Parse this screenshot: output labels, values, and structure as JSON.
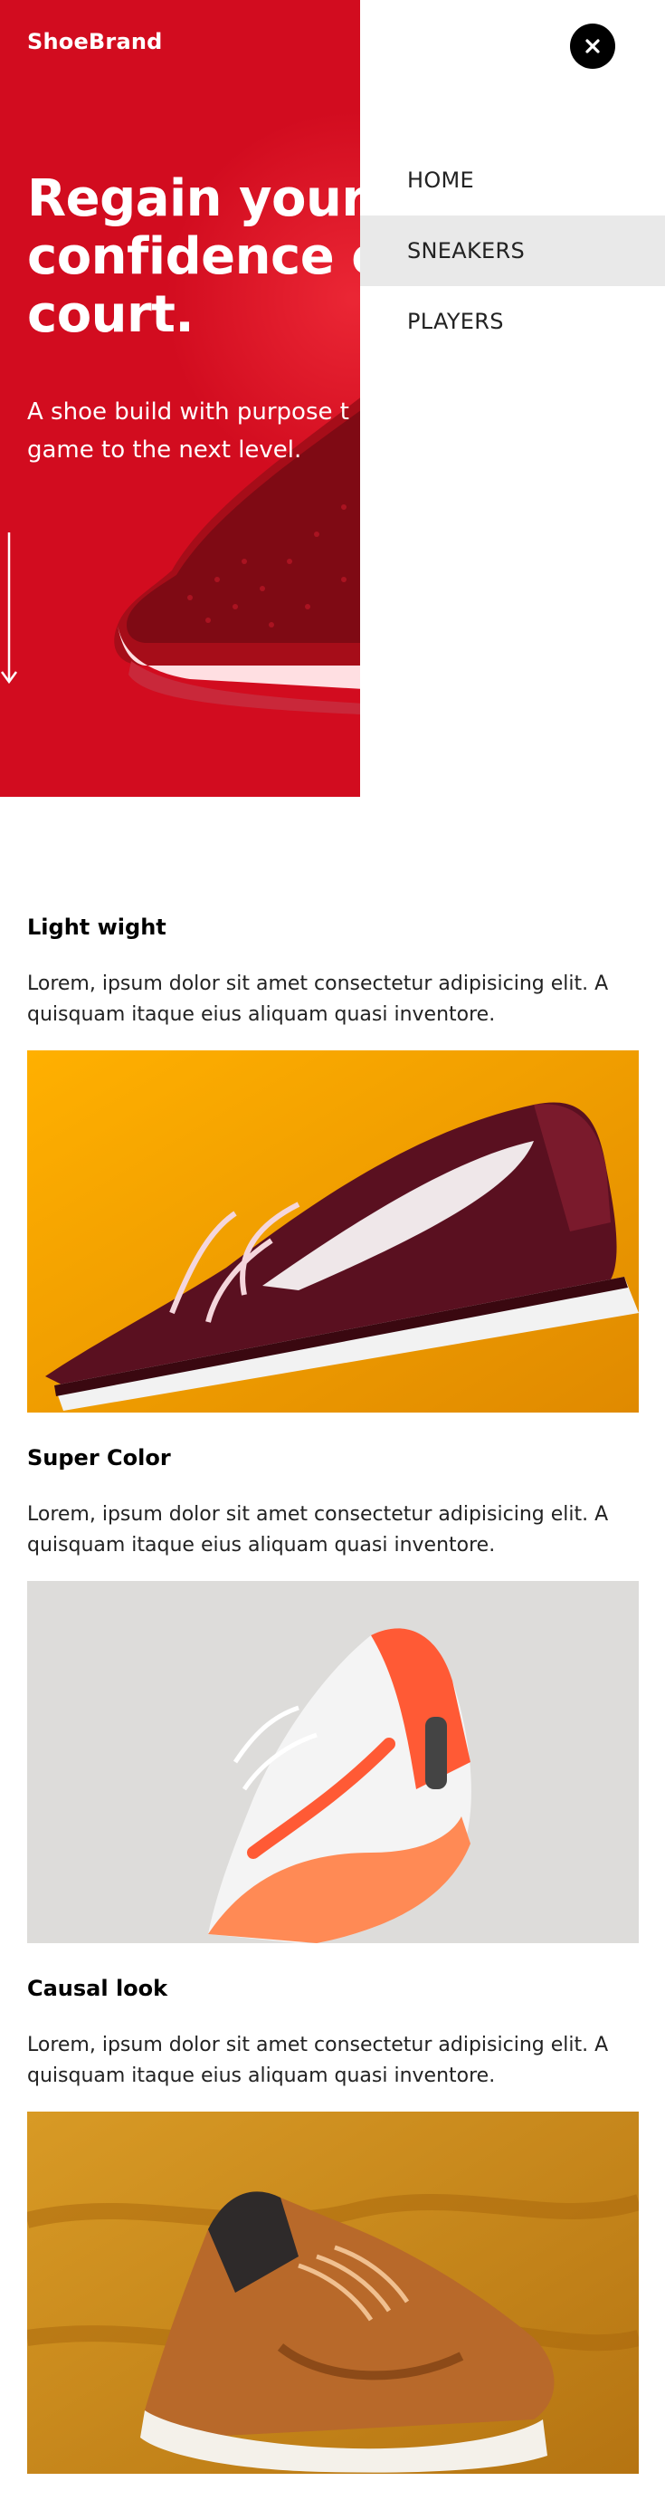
{
  "brand": "ShoeBrand",
  "hero": {
    "headline_line1": "Regain your",
    "headline_line2": "confidence o",
    "headline_line3": "court.",
    "subtitle_line1": "A shoe build with purpose t",
    "subtitle_line2": "game to the next level."
  },
  "nav": {
    "items": [
      {
        "label": "HOME"
      },
      {
        "label": "SNEAKERS"
      },
      {
        "label": "PLAYERS"
      }
    ],
    "active_index": 1
  },
  "sections": [
    {
      "title": "Light wight",
      "text": "Lorem, ipsum dolor sit amet consectetur adipisicing elit. A quisquam itaque eius aliquam quasi inventore."
    },
    {
      "title": "Super Color",
      "text": "Lorem, ipsum dolor sit amet consectetur adipisicing elit. A quisquam itaque eius aliquam quasi inventore."
    },
    {
      "title": "Causal look",
      "text": "Lorem, ipsum dolor sit amet consectetur adipisicing elit. A quisquam itaque eius aliquam quasi inventore."
    }
  ],
  "colors": {
    "hero_red": "#d20c1f",
    "nav_active_bg": "#e9e9e9",
    "close_button_bg": "#000000"
  }
}
